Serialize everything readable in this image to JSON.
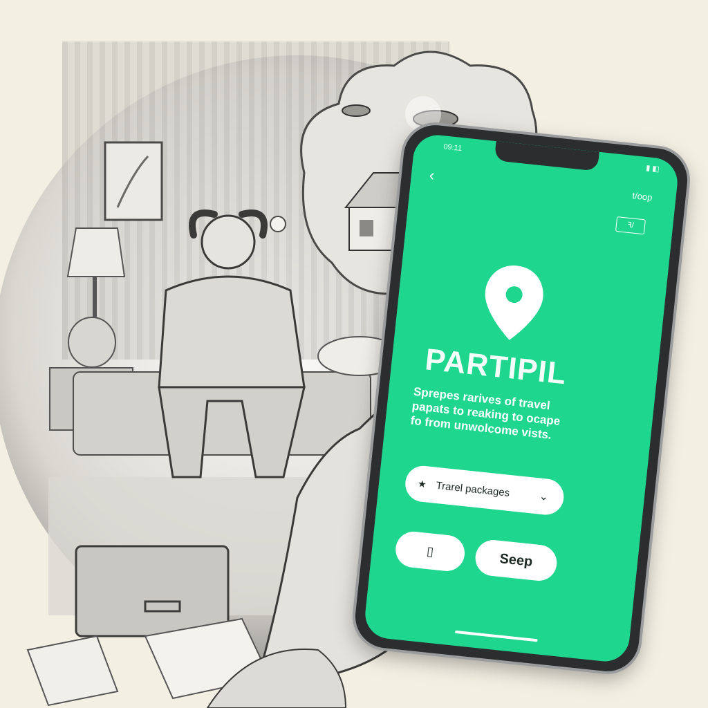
{
  "status": {
    "time": "09:11",
    "icons": "▮ ◧"
  },
  "header": {
    "back_label": "‹",
    "right_label": "t/oop",
    "toggle_label": "ꟻ/"
  },
  "app": {
    "name": "PARTIPIL",
    "tagline": "Sprepes rarives of travel papats to reaking to ocape fo from unwolcome vists."
  },
  "package_select": {
    "value": "Trarel packages",
    "star": "★",
    "chevron": "⌄"
  },
  "buttons": {
    "left_label": "▯",
    "right_label": "Seep"
  },
  "colors": {
    "accent": "#1fd68f",
    "phone_frame": "#2b2d2f"
  }
}
